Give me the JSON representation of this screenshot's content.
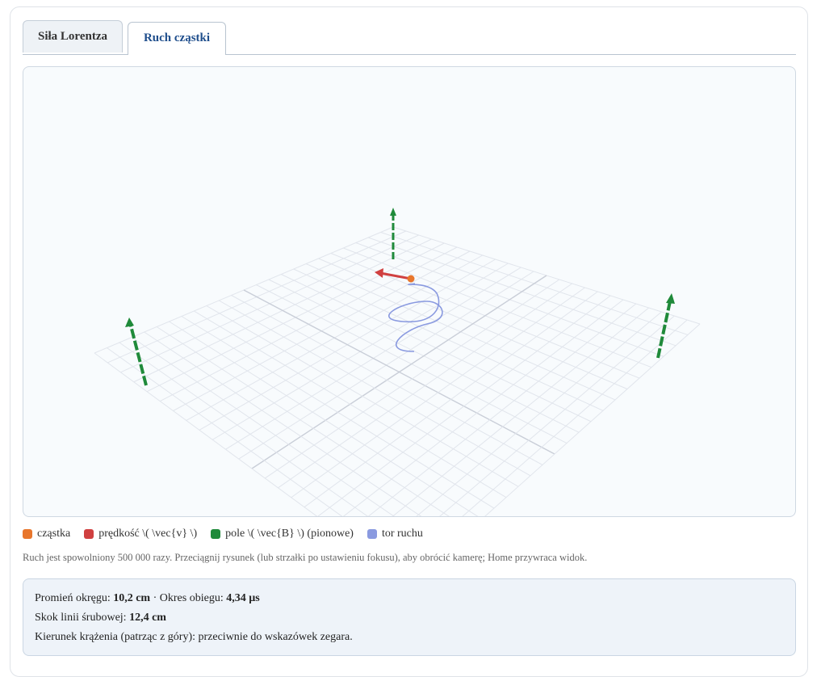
{
  "tabs": [
    {
      "label": "Siła Lorentza",
      "active": false
    },
    {
      "label": "Ruch cząstki",
      "active": true
    }
  ],
  "legend": [
    {
      "label": "cząstka",
      "color": "#e8762c",
      "icon": "particle"
    },
    {
      "label": "prędkość \\( \\vec{v} \\)",
      "color": "#d04040",
      "icon": "velocity-arrow"
    },
    {
      "label": "pole \\( \\vec{B} \\) (pionowe)",
      "color": "#1f8a3a",
      "icon": "field-arrow"
    },
    {
      "label": "tor ruchu",
      "color": "#8a9ae0",
      "icon": "trajectory"
    }
  ],
  "hint": "Ruch jest spowolniony 500 000 razy. Przeciągnij rysunek (lub strzałki po ustawieniu fokusu), aby obrócić kamerę; Home przywraca widok.",
  "results": {
    "radius_label": "Promień okręgu:",
    "radius_value": "10,2 cm",
    "sep": "·",
    "period_label": "Okres obiegu:",
    "period_value": "4,34 µs",
    "pitch_label": "Skok linii śrubowej:",
    "pitch_value": "12,4 cm",
    "direction_text": "Kierunek krążenia (patrząc z góry): przeciwnie do wskazówek zegara."
  }
}
